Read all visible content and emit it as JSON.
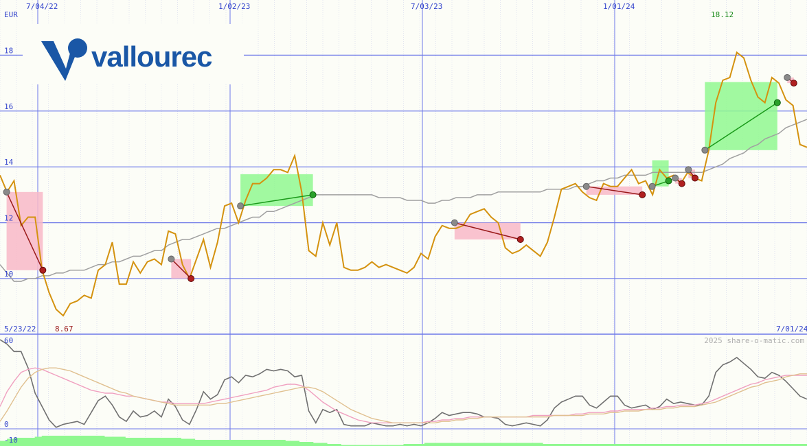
{
  "chart_data": [
    {
      "type": "line",
      "name": "price",
      "currency": "EUR",
      "x_tick_labels": [
        "7/04/22",
        "1/02/23",
        "7/03/23",
        "1/01/24"
      ],
      "start_date": "5/23/22",
      "end_date": "7/01/24",
      "max_label": "18.12",
      "min_label": "8.67",
      "ylim": [
        8,
        19
      ],
      "y_ticks": [
        10,
        12,
        14,
        16,
        18
      ],
      "grid": true,
      "series": [
        {
          "values": [
            13.7,
            13.1,
            13.5,
            11.9,
            12.2,
            12.2,
            10.3,
            9.5,
            8.9,
            8.67,
            9.1,
            9.2,
            9.4,
            9.3,
            10.3,
            10.5,
            11.3,
            9.8,
            9.8,
            10.6,
            10.2,
            10.6,
            10.7,
            10.5,
            11.7,
            11.6,
            10.5,
            10.0,
            10.7,
            11.4,
            10.4,
            11.3,
            12.6,
            12.7,
            12.0,
            12.8,
            13.4,
            13.4,
            13.6,
            13.9,
            13.9,
            13.8,
            14.4,
            13.1,
            11.0,
            10.8,
            12.0,
            11.2,
            12.0,
            10.4,
            10.3,
            10.3,
            10.4,
            10.6,
            10.4,
            10.5,
            10.4,
            10.3,
            10.2,
            10.4,
            10.9,
            10.7,
            11.5,
            11.9,
            11.8,
            11.8,
            11.9,
            12.3,
            12.4,
            12.5,
            12.2,
            12.0,
            11.1,
            10.9,
            11.0,
            11.2,
            11.0,
            10.8,
            11.3,
            12.2,
            13.2,
            13.3,
            13.4,
            13.1,
            12.9,
            12.8,
            13.4,
            13.3,
            13.3,
            13.6,
            13.9,
            13.4,
            13.5,
            13.0,
            13.9,
            13.6,
            13.7,
            13.4,
            13.8,
            13.6,
            13.5,
            14.6,
            16.3,
            17.1,
            17.2,
            18.1,
            17.9,
            17.1,
            16.5,
            16.3,
            17.2,
            17.0,
            16.4,
            16.2,
            14.8,
            14.7
          ],
          "color": "#d4920f"
        },
        {
          "name": "moving average",
          "values": [
            10.5,
            10.2,
            9.9,
            9.9,
            10.0,
            10.0,
            10.1,
            10.1,
            10.2,
            10.2,
            10.3,
            10.3,
            10.3,
            10.4,
            10.5,
            10.5,
            10.6,
            10.6,
            10.7,
            10.8,
            10.8,
            10.9,
            11.0,
            11.0,
            11.2,
            11.3,
            11.4,
            11.4,
            11.5,
            11.6,
            11.7,
            11.8,
            11.8,
            11.9,
            12.0,
            12.1,
            12.2,
            12.2,
            12.4,
            12.4,
            12.5,
            12.6,
            12.7,
            12.8,
            12.9,
            13.0,
            13.0,
            13.0,
            13.0,
            13.0,
            13.0,
            13.0,
            13.0,
            13.0,
            12.9,
            12.9,
            12.9,
            12.9,
            12.8,
            12.8,
            12.8,
            12.7,
            12.7,
            12.8,
            12.8,
            12.9,
            12.9,
            12.9,
            13.0,
            13.0,
            13.0,
            13.1,
            13.1,
            13.1,
            13.1,
            13.1,
            13.1,
            13.1,
            13.2,
            13.2,
            13.2,
            13.2,
            13.3,
            13.3,
            13.4,
            13.5,
            13.5,
            13.6,
            13.6,
            13.7,
            13.7,
            13.7,
            13.7,
            13.8,
            13.8,
            13.8,
            13.8,
            13.8,
            13.8,
            13.8,
            13.8,
            13.9,
            14.0,
            14.1,
            14.3,
            14.4,
            14.5,
            14.7,
            14.8,
            15.0,
            15.1,
            15.2,
            15.4,
            15.5,
            15.6,
            15.7
          ],
          "color": "#a0a0a0"
        }
      ],
      "signals": [
        {
          "from": [
            2,
            13.1
          ],
          "to": [
            13,
            10.3
          ],
          "kind": "sell"
        },
        {
          "from": [
            52,
            10.7
          ],
          "to": [
            58,
            10.0
          ],
          "kind": "sell"
        },
        {
          "from": [
            73,
            12.6
          ],
          "to": [
            95,
            13.0
          ],
          "kind": "buy"
        },
        {
          "from": [
            138,
            12.0
          ],
          "to": [
            158,
            11.4
          ],
          "kind": "sell"
        },
        {
          "from": [
            178,
            13.3
          ],
          "to": [
            195,
            13.0
          ],
          "kind": "sell"
        },
        {
          "from": [
            198,
            13.3
          ],
          "to": [
            203,
            13.5
          ],
          "kind": "buy"
        },
        {
          "from": [
            205,
            13.6
          ],
          "to": [
            207,
            13.4
          ],
          "kind": "sell"
        },
        {
          "from": [
            209,
            13.9
          ],
          "to": [
            211,
            13.6
          ],
          "kind": "sell"
        },
        {
          "from": [
            214,
            14.6
          ],
          "to": [
            236,
            16.3
          ],
          "kind": "buy"
        },
        {
          "from": [
            239,
            17.2
          ],
          "to": [
            241,
            17.0
          ],
          "kind": "sell"
        }
      ]
    },
    {
      "type": "line",
      "name": "oscillator",
      "ylim": [
        -10,
        60
      ],
      "y_ticks_labels": [
        "60",
        "0",
        "-10"
      ],
      "series": [
        {
          "values": [
            60,
            57,
            52,
            52,
            41,
            24,
            15,
            6,
            1,
            3,
            4,
            5,
            3,
            11,
            19,
            22,
            16,
            8,
            5,
            12,
            8,
            9,
            12,
            8,
            20,
            15,
            6,
            3,
            13,
            25,
            20,
            23,
            33,
            35,
            31,
            36,
            35,
            37,
            40,
            39,
            40,
            39,
            35,
            36,
            12,
            4,
            13,
            11,
            13,
            3,
            2,
            2,
            2,
            4,
            3,
            2,
            2,
            3,
            2,
            3,
            2,
            4,
            7,
            11,
            9,
            10,
            11,
            11,
            10,
            8,
            8,
            7,
            3,
            2,
            3,
            4,
            3,
            2,
            6,
            14,
            18,
            20,
            22,
            22,
            16,
            14,
            18,
            22,
            22,
            16,
            14,
            15,
            16,
            13,
            15,
            20,
            17,
            18,
            17,
            16,
            16,
            22,
            38,
            43,
            45,
            48,
            44,
            40,
            35,
            34,
            38,
            36,
            32,
            27,
            22,
            20
          ],
          "color": "#707070"
        },
        {
          "values": [
            15,
            25,
            32,
            38,
            40,
            41,
            40,
            38,
            36,
            34,
            32,
            30,
            28,
            26,
            25,
            24,
            24,
            23,
            22,
            22,
            21,
            20,
            19,
            18,
            18,
            17,
            17,
            17,
            17,
            17,
            18,
            19,
            20,
            21,
            22,
            23,
            24,
            25,
            26,
            28,
            29,
            30,
            30,
            29,
            26,
            22,
            18,
            15,
            12,
            10,
            8,
            6,
            5,
            4,
            4,
            4,
            4,
            4,
            4,
            4,
            4,
            5,
            5,
            6,
            6,
            7,
            7,
            8,
            8,
            8,
            8,
            8,
            8,
            8,
            8,
            8,
            9,
            9,
            9,
            9,
            9,
            9,
            10,
            10,
            11,
            11,
            11,
            12,
            12,
            13,
            13,
            13,
            13,
            14,
            14,
            15,
            15,
            16,
            16,
            16,
            17,
            18,
            20,
            22,
            24,
            26,
            28,
            30,
            31,
            33,
            34,
            35,
            36,
            36,
            36,
            36
          ],
          "color": "#f0a0c0"
        },
        {
          "values": [
            5,
            12,
            20,
            28,
            34,
            38,
            40,
            41,
            41,
            40,
            39,
            37,
            35,
            33,
            31,
            29,
            27,
            25,
            24,
            22,
            21,
            20,
            19,
            18,
            17,
            16,
            16,
            16,
            16,
            16,
            16,
            17,
            17,
            18,
            19,
            20,
            21,
            22,
            23,
            24,
            25,
            26,
            27,
            28,
            28,
            27,
            25,
            22,
            19,
            16,
            13,
            11,
            9,
            7,
            6,
            5,
            4,
            4,
            4,
            4,
            4,
            4,
            4,
            5,
            5,
            6,
            6,
            7,
            7,
            8,
            8,
            8,
            8,
            8,
            8,
            8,
            8,
            8,
            8,
            9,
            9,
            9,
            9,
            9,
            10,
            10,
            10,
            11,
            11,
            12,
            12,
            12,
            13,
            13,
            13,
            14,
            14,
            15,
            15,
            15,
            16,
            17,
            18,
            20,
            22,
            24,
            26,
            28,
            29,
            31,
            32,
            33,
            35,
            36,
            37,
            37
          ],
          "color": "#e0c090"
        }
      ],
      "bars": [
        5,
        7,
        8,
        8,
        8,
        9,
        10,
        10,
        10,
        10,
        10,
        10,
        10,
        10,
        10,
        9,
        9,
        9,
        8,
        8,
        8,
        8,
        8,
        8,
        8,
        8,
        7,
        7,
        6,
        6,
        6,
        6,
        6,
        6,
        6,
        6,
        6,
        6,
        6,
        6,
        6,
        5,
        5,
        4,
        4,
        3,
        3,
        2,
        2,
        1,
        1,
        1,
        1,
        1,
        1,
        1,
        1,
        1,
        2,
        2,
        2,
        3,
        3,
        3,
        3,
        3,
        3,
        3,
        3,
        3,
        3,
        3,
        3,
        3,
        3,
        3,
        3,
        3,
        2,
        2,
        2,
        2,
        2,
        2,
        2,
        2,
        2,
        2,
        2,
        2,
        2,
        2,
        2,
        2,
        2,
        2,
        2,
        2,
        2,
        2,
        2,
        2,
        2,
        2,
        2,
        2,
        2,
        2,
        2,
        2,
        2,
        2,
        2,
        2,
        2,
        2
      ],
      "bar_color": "#90f890"
    }
  ],
  "copyright": "2025 share-o-matic.com",
  "logo_text": "vallourec",
  "colors": {
    "grid": "#6d78e8",
    "grid_minor": "#c8cde8",
    "price": "#d4920f",
    "buy_fill": "#90f890",
    "sell_fill": "#f8b8c8",
    "buy_line": "#1a9a1a",
    "sell_line": "#9a1a1a",
    "max_color": "#1a8a1a",
    "min_color": "#9a1a1a",
    "logo_blue": "#1a57a6"
  }
}
